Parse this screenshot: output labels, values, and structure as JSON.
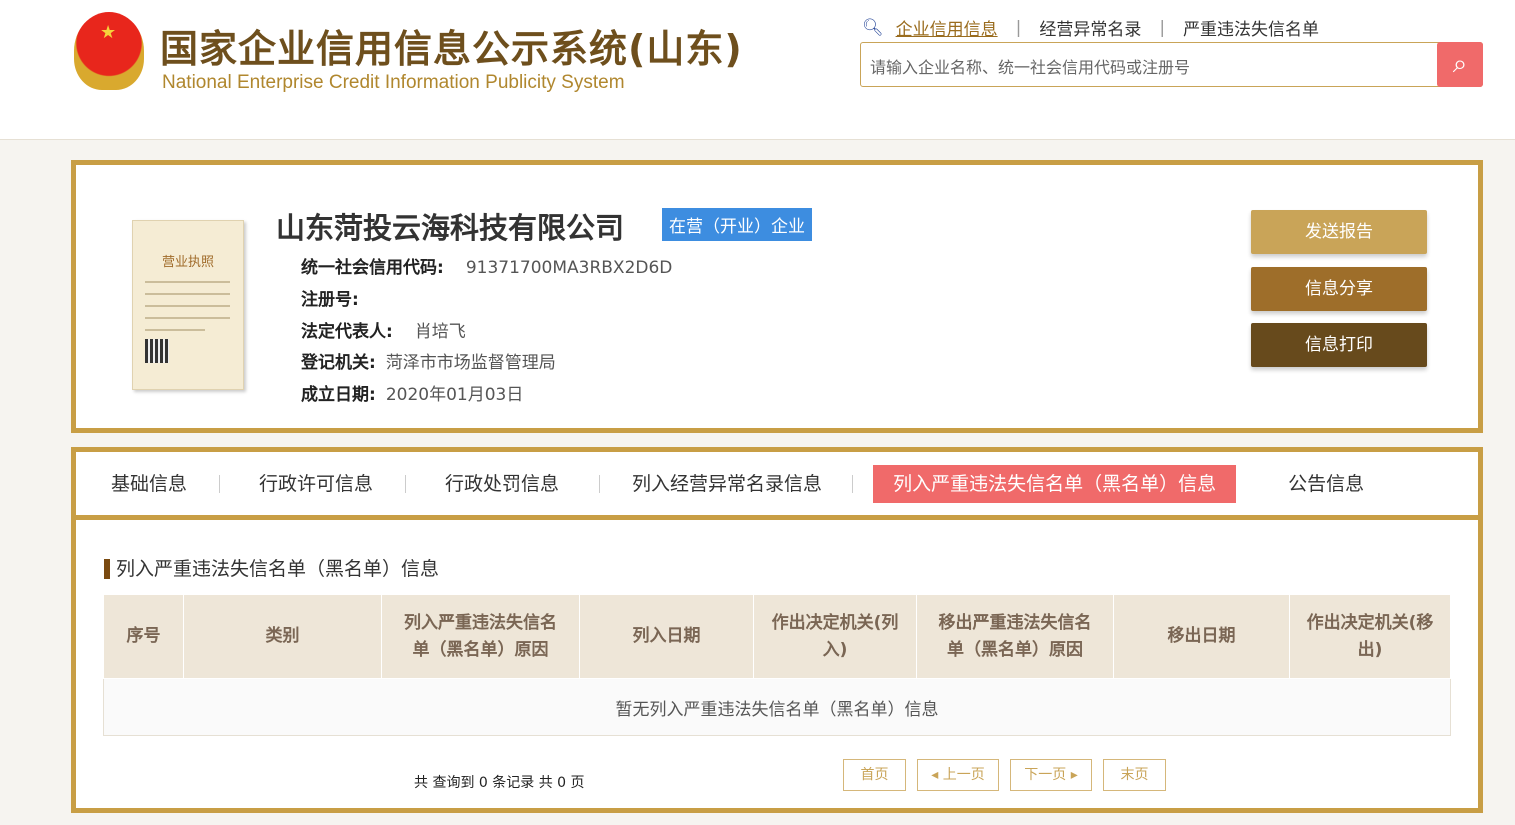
{
  "header": {
    "title_cn": "国家企业信用信息公示系统(山东)",
    "title_en": "National Enterprise Credit Information Publicity System",
    "links": [
      "企业信用信息",
      "经营异常名录",
      "严重违法失信名单"
    ],
    "search_placeholder": "请输入企业名称、统一社会信用代码或注册号"
  },
  "company": {
    "name": "山东菏投云海科技有限公司",
    "status": "在营（开业）企业",
    "license_title": "营业执照",
    "fields": [
      {
        "label": "统一社会信用代码:",
        "value": "91371700MA3RBX2D6D"
      },
      {
        "label": "注册号:",
        "value": ""
      },
      {
        "label": "法定代表人:",
        "value": "肖培飞"
      },
      {
        "label": "登记机关:",
        "value": "菏泽市市场监督管理局"
      },
      {
        "label": "成立日期:",
        "value": "2020年01月03日"
      }
    ],
    "actions": [
      "发送报告",
      "信息分享",
      "信息打印"
    ]
  },
  "tabs": [
    "基础信息",
    "行政许可信息",
    "行政处罚信息",
    "列入经营异常名录信息",
    "列入严重违法失信名单（黑名单）信息",
    "公告信息"
  ],
  "section": {
    "title": "列入严重违法失信名单（黑名单）信息",
    "columns": [
      "序号",
      "类别",
      "列入严重违法失信名单（黑名单）原因",
      "列入日期",
      "作出决定机关(列入)",
      "移出严重违法失信名单（黑名单）原因",
      "移出日期",
      "作出决定机关(移出)"
    ],
    "empty": "暂无列入严重违法失信名单（黑名单）信息"
  },
  "pagination": {
    "summary": "共 查询到 0 条记录 共 0 页",
    "first": "首页",
    "prev": "◂ 上一页",
    "next": "下一页 ▸",
    "last": "末页"
  }
}
